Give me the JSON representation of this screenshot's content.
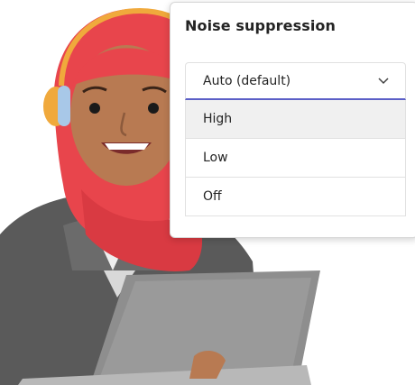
{
  "panel": {
    "title": "Noise suppression"
  },
  "dropdown": {
    "selected": "Auto (default)",
    "options": [
      "High",
      "Low",
      "Off"
    ],
    "highlighted_option": "High"
  },
  "colors": {
    "accent": "#5b5fc7",
    "hijab": "#e8454c",
    "headset": "#f0a93c",
    "skin": "#b87a52",
    "jacket": "#5f5f5f",
    "laptop": "#8e8e8e"
  },
  "icons": {
    "chevron": "chevron-down-icon"
  }
}
